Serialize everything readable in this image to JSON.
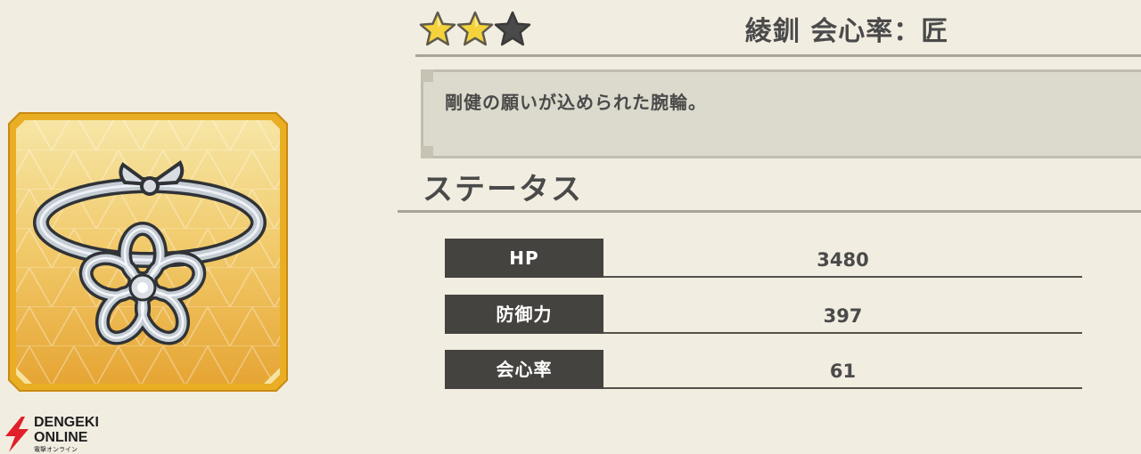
{
  "item": {
    "name": "綾釧 会心率：匠",
    "description": "剛健の願いが込められた腕輪。",
    "rarity": {
      "stars_filled": 2,
      "stars_total": 3
    },
    "icon": "bracelet-icon"
  },
  "status": {
    "title": "ステータス",
    "rows": [
      {
        "label": "HP",
        "value": "3480"
      },
      {
        "label": "防御力",
        "value": "397"
      },
      {
        "label": "会心率",
        "value": "61"
      }
    ]
  },
  "watermark": {
    "line1": "DENGEKI",
    "line2": "ONLINE",
    "line3": "電撃オンライン"
  },
  "colors": {
    "background": "#f2ede1",
    "label_bg": "#45433f",
    "star_gold": "#f3d23c",
    "star_empty": "#4a4a4a",
    "frame_gold": "#e9ae23"
  }
}
